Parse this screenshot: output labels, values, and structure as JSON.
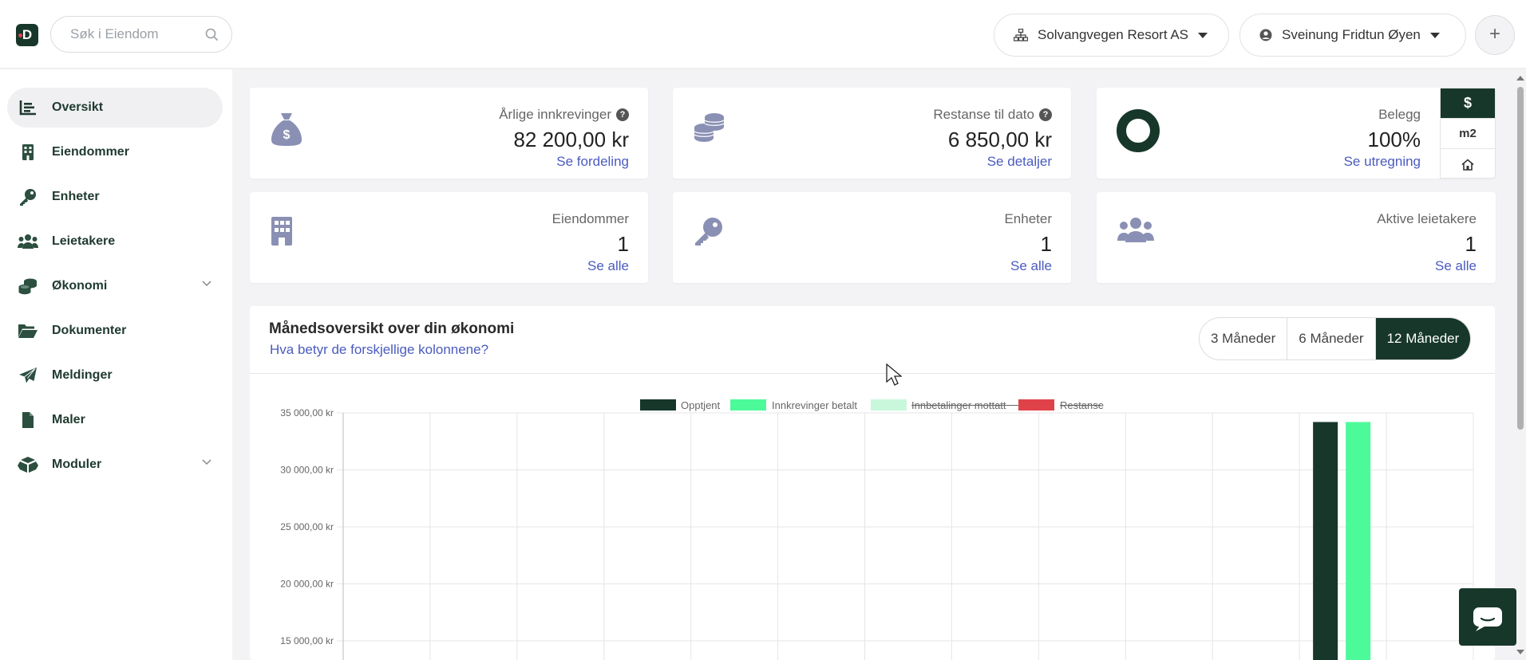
{
  "header": {
    "logo_letter": "D",
    "search_placeholder": "Søk i Eiendom",
    "company": "Solvangvegen Resort AS",
    "user": "Sveinung Fridtun Øyen",
    "plus": "+"
  },
  "sidebar": {
    "items": [
      {
        "label": "Oversikt",
        "icon": "list-icon",
        "active": true
      },
      {
        "label": "Eiendommer",
        "icon": "building-icon"
      },
      {
        "label": "Enheter",
        "icon": "key-icon"
      },
      {
        "label": "Leietakere",
        "icon": "users-icon"
      },
      {
        "label": "Økonomi",
        "icon": "coins-icon",
        "expandable": true
      },
      {
        "label": "Dokumenter",
        "icon": "folder-icon"
      },
      {
        "label": "Meldinger",
        "icon": "paper-plane-icon"
      },
      {
        "label": "Maler",
        "icon": "file-icon"
      },
      {
        "label": "Moduler",
        "icon": "boxes-icon",
        "expandable": true
      }
    ]
  },
  "cards": {
    "annual": {
      "label": "Årlige innkrevinger",
      "value": "82 200,00 kr",
      "link": "Se fordeling"
    },
    "arrears": {
      "label": "Restanse til dato",
      "value": "6 850,00 kr",
      "link": "Se detaljer"
    },
    "occupancy": {
      "label": "Belegg",
      "value": "100%",
      "link": "Se utregning",
      "level": 1.0
    },
    "properties": {
      "label": "Eiendommer",
      "value": "1",
      "link": "Se alle"
    },
    "units": {
      "label": "Enheter",
      "value": "1",
      "link": "Se alle"
    },
    "tenants": {
      "label": "Aktive leietakere",
      "value": "1",
      "link": "Se alle"
    }
  },
  "unit_toggle": {
    "dollar": "$",
    "m2": "m2"
  },
  "panel": {
    "title": "Månedsoversikt over din økonomi",
    "link": "Hva betyr de forskjellige kolonnene?",
    "ranges": [
      "3 Måneder",
      "6 Måneder",
      "12 Måneder"
    ],
    "selected_range": "12 Måneder"
  },
  "colors": {
    "brand": "#17372a",
    "accent_link": "#4a5bbf",
    "opptjent": "#17372a",
    "innkrevinger": "#4dfa9a",
    "innbetalinger": "#c8f7dc",
    "restanse": "#e0424a"
  },
  "chart_data": {
    "type": "bar",
    "series": [
      {
        "name": "Opptjent",
        "color": "#17372a",
        "hidden": false
      },
      {
        "name": "Innkrevinger betalt",
        "color": "#4dfa9a",
        "hidden": false
      },
      {
        "name": "Innbetalinger mottatt",
        "color": "#c8f7dc",
        "hidden": true
      },
      {
        "name": "Restanse",
        "color": "#e0424a",
        "hidden": true
      }
    ],
    "y_ticks": [
      "35 000,00 kr",
      "30 000,00 kr",
      "25 000,00 kr",
      "20 000,00 kr",
      "15 000,00 kr"
    ],
    "y_tick_values": [
      35000,
      30000,
      25000,
      20000,
      15000
    ],
    "visible_ylim": [
      15000,
      35000
    ],
    "month_count": 13,
    "bars": [
      {
        "slot": 11,
        "series": "Opptjent",
        "value": 34200
      },
      {
        "slot": 11,
        "series": "Innkrevinger betalt",
        "value": 34200
      }
    ],
    "grid": true,
    "legend": "top"
  }
}
